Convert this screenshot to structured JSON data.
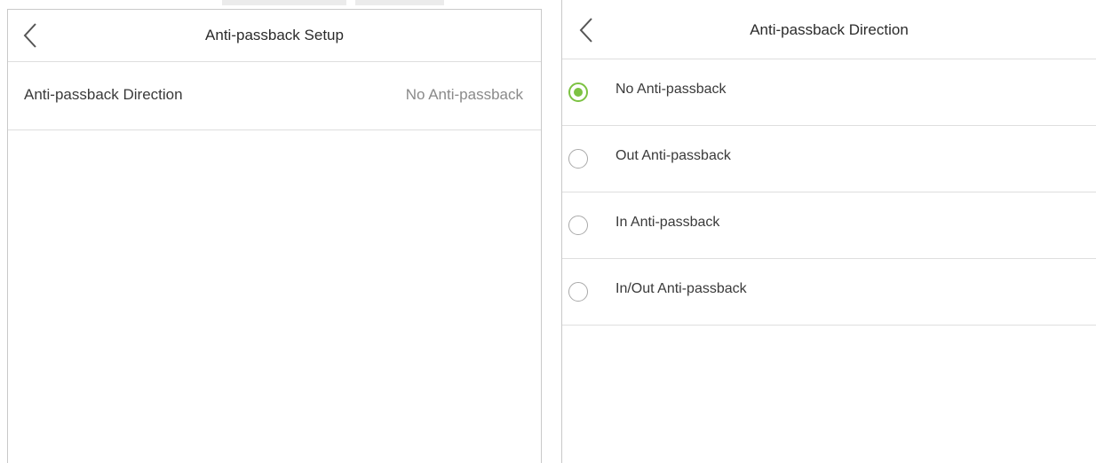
{
  "left_screen": {
    "title": "Anti-passback Setup",
    "back_icon": "chevron-left-icon",
    "rows": [
      {
        "label": "Anti-passback Direction",
        "value": "No Anti-passback"
      }
    ]
  },
  "right_screen": {
    "title": "Anti-passback Direction",
    "back_icon": "chevron-left-icon",
    "selected_index": 0,
    "accent_color": "#7cc242",
    "options": [
      {
        "label": "No Anti-passback",
        "checked": true
      },
      {
        "label": "Out Anti-passback",
        "checked": false
      },
      {
        "label": "In Anti-passback",
        "checked": false
      },
      {
        "label": "In/Out Anti-passback",
        "checked": false
      }
    ]
  }
}
